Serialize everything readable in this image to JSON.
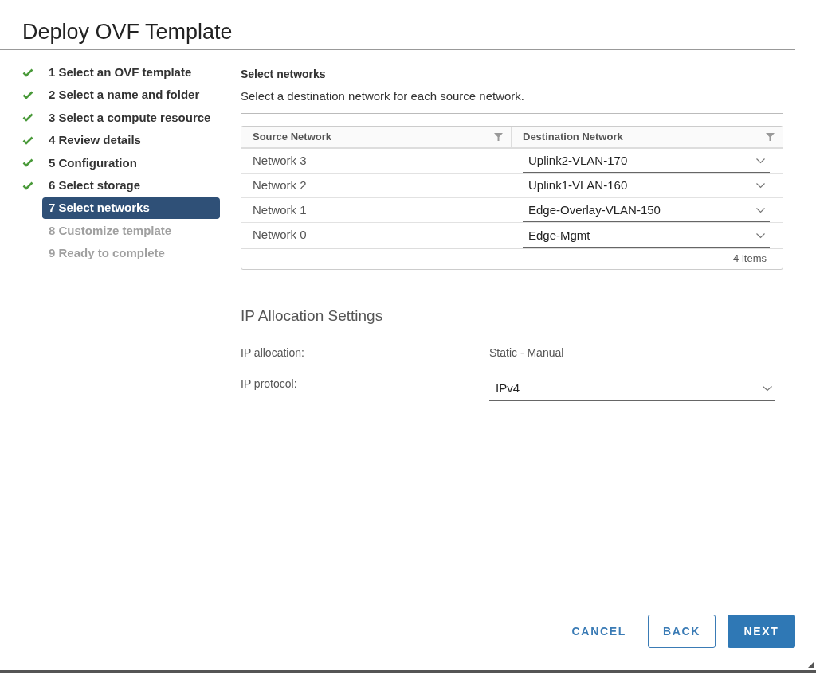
{
  "window": {
    "title": "Deploy OVF Template"
  },
  "steps": [
    {
      "label": "1 Select an OVF template",
      "completed": true,
      "selected": false,
      "disabled": false
    },
    {
      "label": "2 Select a name and folder",
      "completed": true,
      "selected": false,
      "disabled": false
    },
    {
      "label": "3 Select a compute resource",
      "completed": true,
      "selected": false,
      "disabled": false
    },
    {
      "label": "4 Review details",
      "completed": true,
      "selected": false,
      "disabled": false
    },
    {
      "label": "5 Configuration",
      "completed": true,
      "selected": false,
      "disabled": false
    },
    {
      "label": "6 Select storage",
      "completed": true,
      "selected": false,
      "disabled": false
    },
    {
      "label": "7 Select networks",
      "completed": false,
      "selected": true,
      "disabled": false
    },
    {
      "label": "8 Customize template",
      "completed": false,
      "selected": false,
      "disabled": true
    },
    {
      "label": "9 Ready to complete",
      "completed": false,
      "selected": false,
      "disabled": true
    }
  ],
  "section": {
    "title": "Select networks",
    "subtitle": "Select a destination network for each source network."
  },
  "table": {
    "columns": [
      "Source Network",
      "Destination Network"
    ],
    "rows": [
      {
        "source": "Network 3",
        "destination": "Uplink2-VLAN-170"
      },
      {
        "source": "Network 2",
        "destination": "Uplink1-VLAN-160"
      },
      {
        "source": "Network 1",
        "destination": "Edge-Overlay-VLAN-150"
      },
      {
        "source": "Network 0",
        "destination": "Edge-Mgmt"
      }
    ],
    "footer": "4 items"
  },
  "ip_settings": {
    "title": "IP Allocation Settings",
    "fields": [
      {
        "kind": "text",
        "label": "IP allocation:",
        "value": "Static - Manual"
      },
      {
        "kind": "select",
        "label": "IP protocol:",
        "value": "IPv4"
      }
    ]
  },
  "buttons": [
    {
      "label": "CANCEL",
      "kind": "flat"
    },
    {
      "label": "BACK",
      "kind": "outline"
    },
    {
      "label": "NEXT",
      "kind": "primary"
    }
  ]
}
